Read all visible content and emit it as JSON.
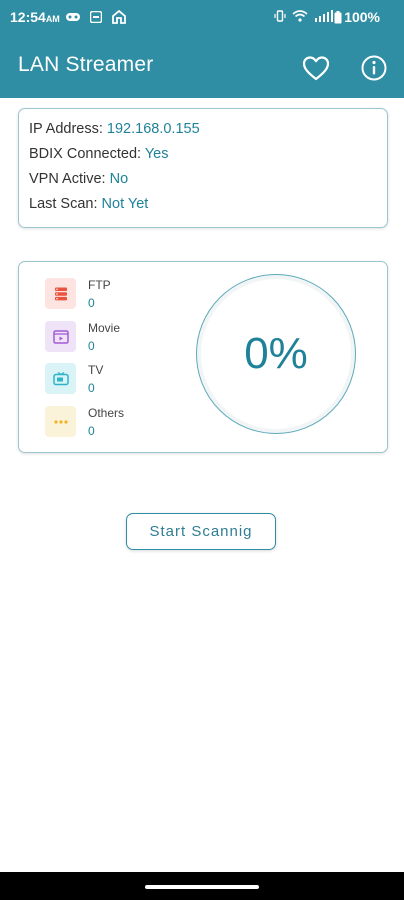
{
  "status_bar": {
    "time": "12:54",
    "am_pm": "AM",
    "battery": "100%"
  },
  "app_bar": {
    "title": "LAN Streamer",
    "favorite_icon": "heart-outline-icon",
    "info_icon": "info-circle-icon"
  },
  "info": {
    "ip_label": "IP Address:",
    "ip_value": "192.168.0.155",
    "bdix_label": "BDIX Connected:",
    "bdix_value": "Yes",
    "vpn_label": "VPN Active:",
    "vpn_value": "No",
    "scan_label": "Last Scan:",
    "scan_value": "Not Yet"
  },
  "stats": [
    {
      "label": "FTP",
      "count": "0",
      "icon": "ftp-server-icon",
      "color": "#e8543f"
    },
    {
      "label": "Movie",
      "count": "0",
      "icon": "movie-icon",
      "color": "#a45ad6"
    },
    {
      "label": "TV",
      "count": "0",
      "icon": "tv-icon",
      "color": "#2db4c9"
    },
    {
      "label": "Others",
      "count": "0",
      "icon": "more-dots-icon",
      "color": "#f0b323"
    }
  ],
  "progress": {
    "percent_label": "0%",
    "percent": 0
  },
  "actions": {
    "scan_button": "Start Scannig"
  },
  "colors": {
    "primary": "#2f8ea3",
    "accent_text": "#1f8299"
  }
}
